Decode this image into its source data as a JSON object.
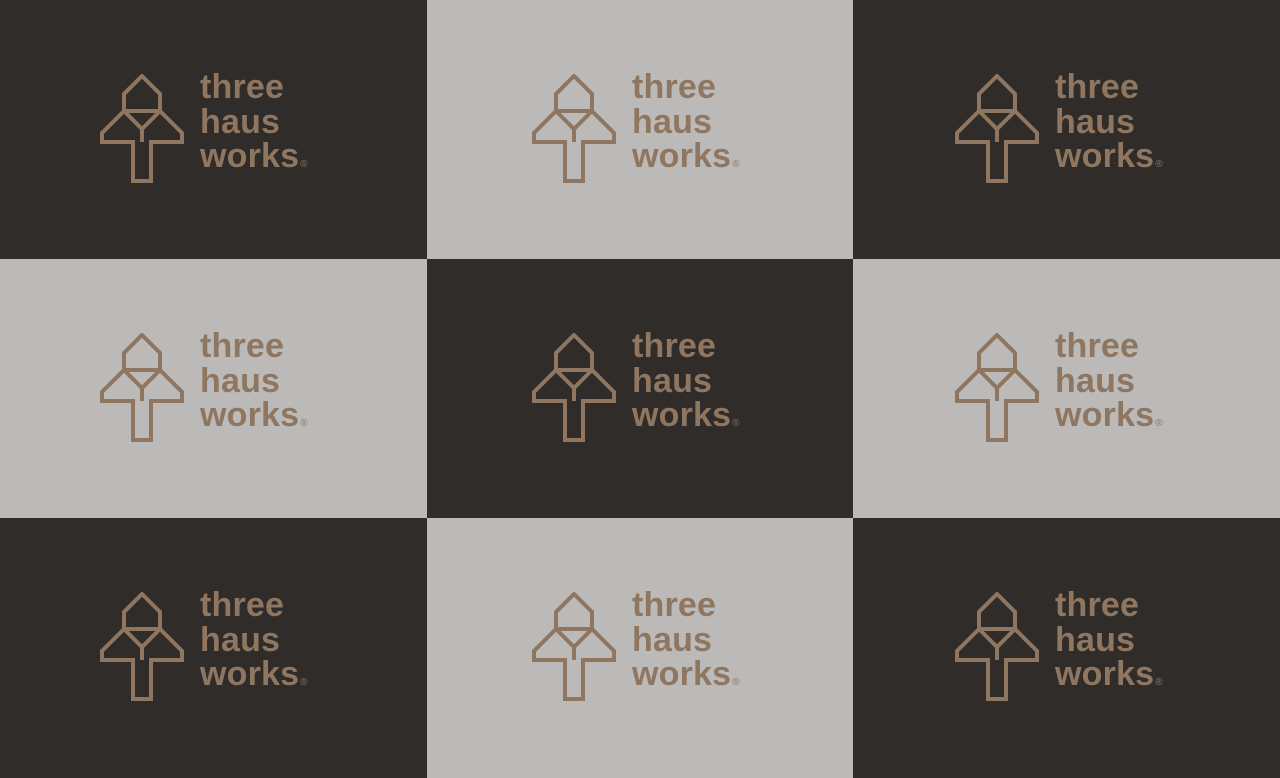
{
  "brand": {
    "line1": "three",
    "line2": "haus",
    "line3": "works",
    "registered": "®",
    "mark_icon": "tree-house-mark-icon"
  },
  "colors": {
    "dark_bg": "#302c2a",
    "light_bg": "#bcbab8",
    "logo": "#8f7660"
  },
  "tiles": [
    {
      "bg": "dark"
    },
    {
      "bg": "light"
    },
    {
      "bg": "dark"
    },
    {
      "bg": "light"
    },
    {
      "bg": "dark"
    },
    {
      "bg": "light"
    },
    {
      "bg": "dark"
    },
    {
      "bg": "light"
    },
    {
      "bg": "dark"
    }
  ]
}
